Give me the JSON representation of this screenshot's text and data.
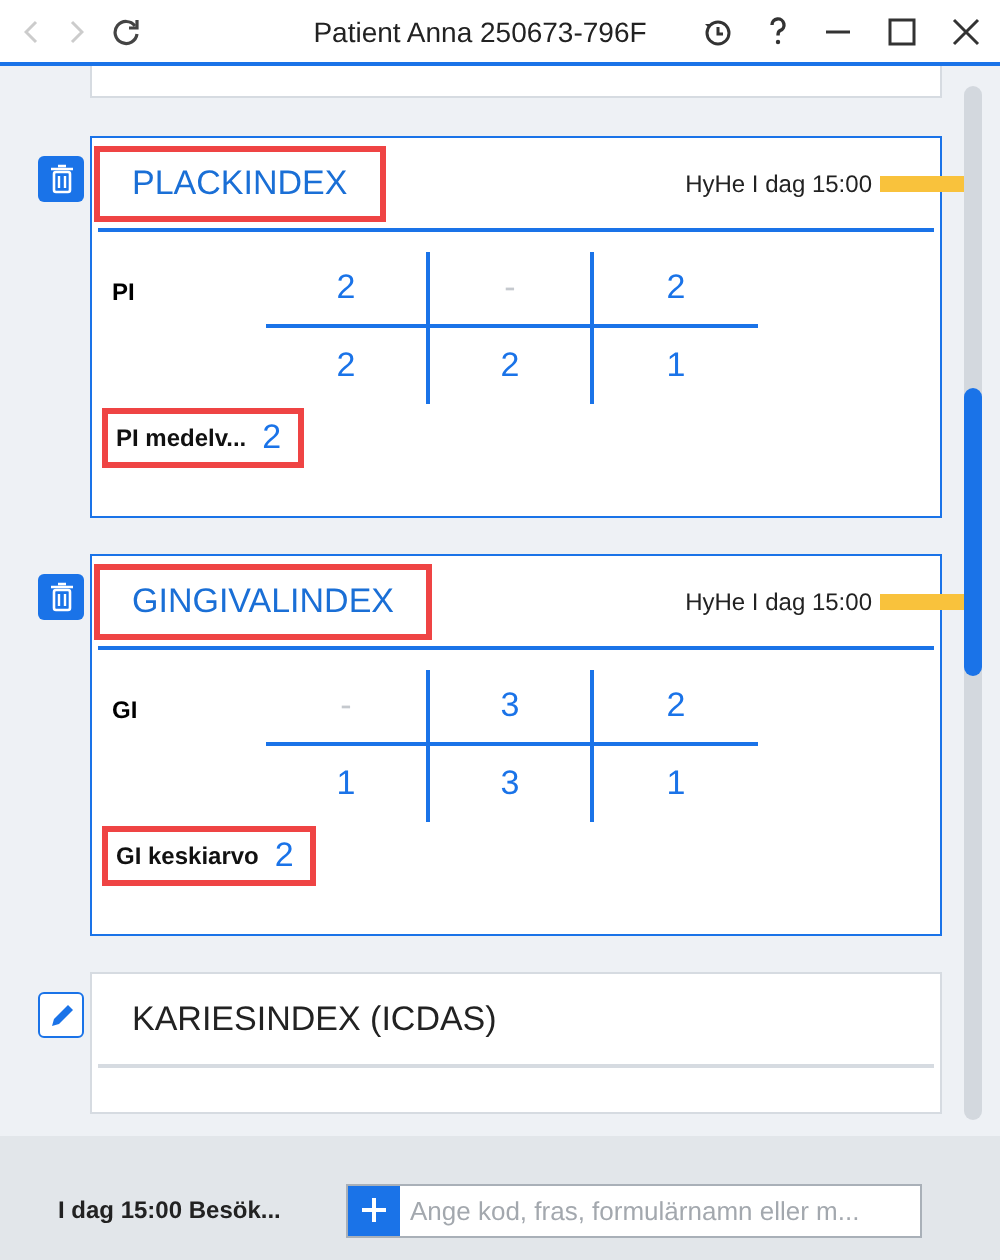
{
  "window": {
    "title": "Patient Anna 250673-796F"
  },
  "cards": [
    {
      "kind": "grid",
      "button": {
        "kind": "delete"
      },
      "title": "PLACKINDEX",
      "highlighted": true,
      "meta": "HyHe I dag 15:00",
      "row_label": "PI",
      "cells": [
        [
          {
            "value": "2",
            "empty": false
          },
          {
            "value": "-",
            "empty": true
          },
          {
            "value": "2",
            "empty": false
          }
        ],
        [
          {
            "value": "2",
            "empty": false
          },
          {
            "value": "2",
            "empty": false
          },
          {
            "value": "1",
            "empty": false
          }
        ]
      ],
      "summary": {
        "label": "PI medelv...",
        "value": "2",
        "highlighted": true
      }
    },
    {
      "kind": "grid",
      "button": {
        "kind": "delete"
      },
      "title": "GINGIVALINDEX",
      "highlighted": true,
      "meta": "HyHe I dag 15:00",
      "row_label": "GI",
      "cells": [
        [
          {
            "value": "-",
            "empty": true
          },
          {
            "value": "3",
            "empty": false
          },
          {
            "value": "2",
            "empty": false
          }
        ],
        [
          {
            "value": "1",
            "empty": false
          },
          {
            "value": "3",
            "empty": false
          },
          {
            "value": "1",
            "empty": false
          }
        ]
      ],
      "summary": {
        "label": "GI keskiarvo",
        "value": "2",
        "highlighted": true
      }
    },
    {
      "kind": "plain",
      "button": {
        "kind": "edit"
      },
      "title": "KARIESINDEX (ICDAS)",
      "highlighted": false
    }
  ],
  "footer": {
    "visit": "I dag 15:00 Besök...",
    "placeholder": "Ange kod, fras, formulärnamn eller m..."
  }
}
